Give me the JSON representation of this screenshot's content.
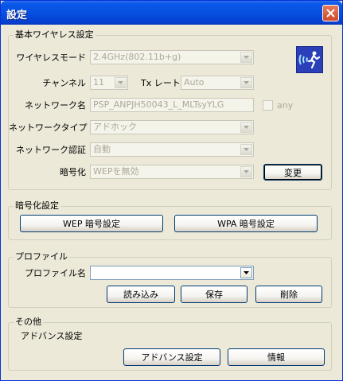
{
  "window": {
    "title": "設定"
  },
  "wireless": {
    "legend": "基本ワイヤレス設定",
    "mode_label": "ワイヤレスモード",
    "mode_value": "2.4GHz(802.11b+g)",
    "channel_label": "チャンネル",
    "channel_value": "11",
    "txrate_label": "Tx レート",
    "txrate_value": "Auto",
    "network_name_label": "ネットワーク名",
    "network_name_value": "PSP_ANPJH50043_L_MLTsyYLG",
    "any_label": "any",
    "network_type_label": "ネットワークタイプ",
    "network_type_value": "アドホック",
    "auth_label": "ネットワーク認証",
    "auth_value": "自動",
    "encryption_label": "暗号化",
    "encryption_value": "WEPを無効",
    "change_button": "変更"
  },
  "encryption_settings": {
    "legend": "暗号化設定",
    "wep_button": "WEP 暗号設定",
    "wpa_button": "WPA 暗号設定"
  },
  "profile": {
    "legend": "プロファイル",
    "name_label": "プロファイル名",
    "name_value": "",
    "load_button": "読み込み",
    "save_button": "保存",
    "delete_button": "削除"
  },
  "other": {
    "legend": "その他",
    "advanced_label": "アドバンス設定",
    "advanced_button": "アドバンス設定",
    "info_button": "情報"
  }
}
